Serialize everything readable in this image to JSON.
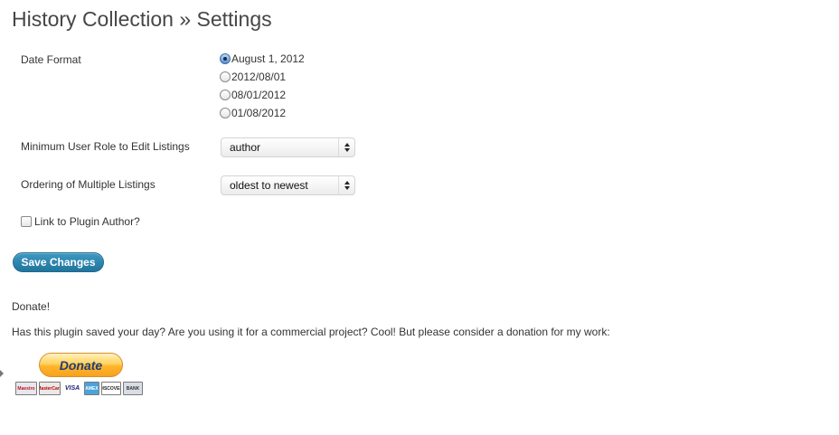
{
  "page": {
    "title": "History Collection » Settings"
  },
  "settings": {
    "date_format": {
      "label": "Date Format",
      "options": [
        "August 1, 2012",
        "2012/08/01",
        "08/01/2012",
        "01/08/2012"
      ],
      "selected": "August 1, 2012"
    },
    "min_role": {
      "label": "Minimum User Role to Edit Listings",
      "value": "author"
    },
    "ordering": {
      "label": "Ordering of Multiple Listings",
      "value": "oldest to newest"
    },
    "link_author": {
      "label": "Link to Plugin Author?",
      "checked": false
    }
  },
  "actions": {
    "save_label": "Save Changes"
  },
  "donate": {
    "heading": "Donate!",
    "text": "Has this plugin saved your day? Are you using it for a commercial project? Cool! But please consider a donation for my work:",
    "button_label": "Donate",
    "cards": [
      "Maestro",
      "MasterCard",
      "VISA",
      "AMEX",
      "DISCOVER",
      "BANK"
    ]
  },
  "colors": {
    "primary_button": "#21759b",
    "donate_button": "#ffb52f",
    "title_text": "#464646"
  }
}
